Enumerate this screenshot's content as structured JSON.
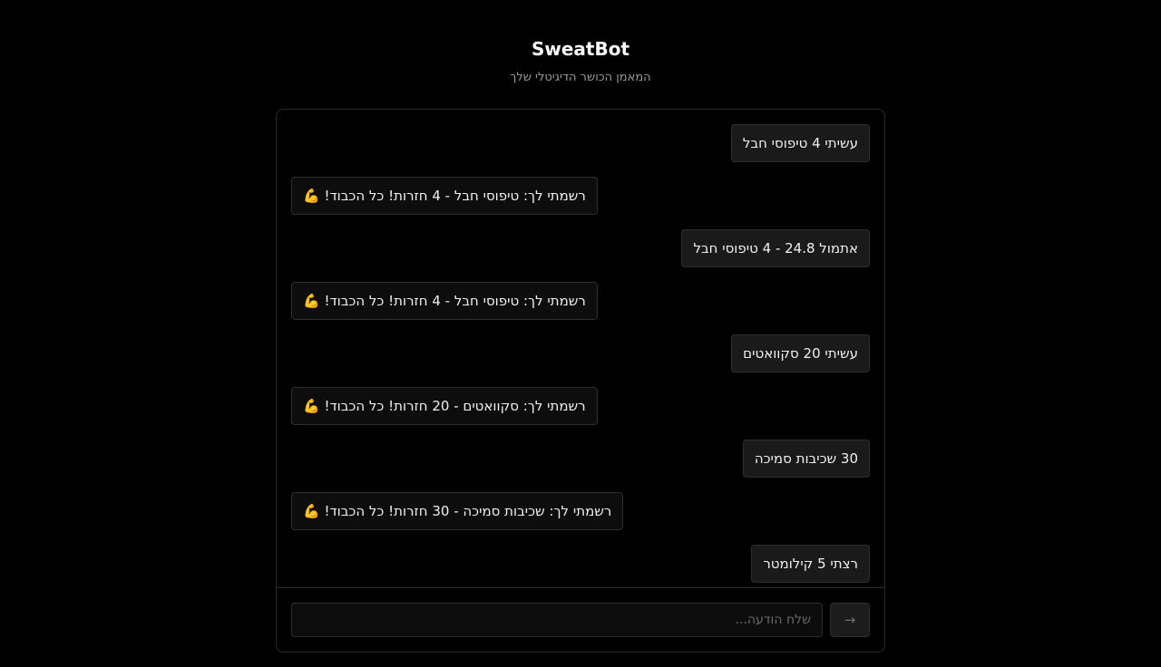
{
  "header": {
    "title": "SweatBot",
    "subtitle": "המאמן הכושר הדיגיטלי שלך"
  },
  "messages": [
    {
      "role": "user",
      "text": "עשיתי 4 טיפוסי חבל"
    },
    {
      "role": "bot",
      "text": "רשמתי לך: טיפוסי חבל - 4 חזרות! כל הכבוד! 💪"
    },
    {
      "role": "user",
      "text": "אתמול 24.8 - 4 טיפוסי חבל"
    },
    {
      "role": "bot",
      "text": "רשמתי לך: טיפוסי חבל - 4 חזרות! כל הכבוד! 💪"
    },
    {
      "role": "user",
      "text": "עשיתי 20 סקוואטים"
    },
    {
      "role": "bot",
      "text": "רשמתי לך: סקוואטים - 20 חזרות! כל הכבוד! 💪"
    },
    {
      "role": "user",
      "text": "30 שכיבות סמיכה"
    },
    {
      "role": "bot",
      "text": "רשמתי לך: שכיבות סמיכה - 30 חזרות! כל הכבוד! 💪"
    },
    {
      "role": "user",
      "text": "רצתי 5 קילומטר"
    }
  ],
  "composer": {
    "placeholder": "שלח הודעה...",
    "value": "",
    "send_label": "→",
    "send_icon": "arrow-right-icon"
  },
  "colors": {
    "background": "#000000",
    "bubble_user": "#1a1a1a",
    "bubble_bot": "#0d0d0d",
    "border": "#2e2e2e",
    "subtitle": "#9a9a9a"
  }
}
